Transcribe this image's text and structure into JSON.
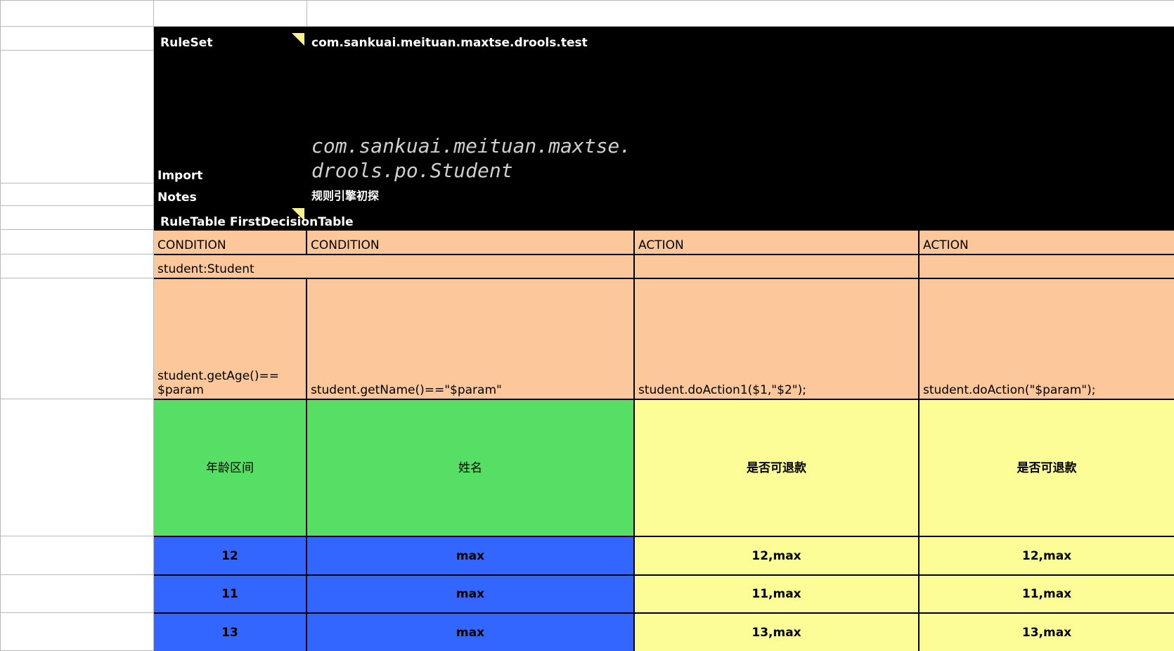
{
  "ruleset": {
    "label": "RuleSet",
    "value": "com.sankuai.meituan.maxtse.drools.test"
  },
  "import": {
    "label": "Import",
    "value": "com.sankuai.meituan.maxtse.drools.po.Student"
  },
  "notes": {
    "label": "Notes",
    "value": "规则引擎初探"
  },
  "ruletable": {
    "label": "RuleTable FirstDecisionTable"
  },
  "columns": [
    {
      "type": "CONDITION",
      "code": "student.getAge()==\n$param",
      "header": "年龄区间"
    },
    {
      "type": "CONDITION",
      "code": "student.getName()==\"$param\"",
      "header": "姓名"
    },
    {
      "type": "ACTION",
      "code": "student.doAction1($1,\"$2\");",
      "header": "是否可退款"
    },
    {
      "type": "ACTION",
      "code": "student.doAction(\"$param\");",
      "header": "是否可退款"
    }
  ],
  "object_type": "student:Student",
  "rows": [
    [
      "12",
      "max",
      "12,max",
      "12,max"
    ],
    [
      "11",
      "max",
      "11,max",
      "11,max"
    ],
    [
      "13",
      "max",
      "13,max",
      "13,max"
    ]
  ],
  "colors": {
    "header_black": "#000000",
    "condition_orange": "#fcc89b",
    "header_green": "#56df64",
    "data_blue": "#3366ff",
    "action_yellow": "#fdfd98"
  }
}
